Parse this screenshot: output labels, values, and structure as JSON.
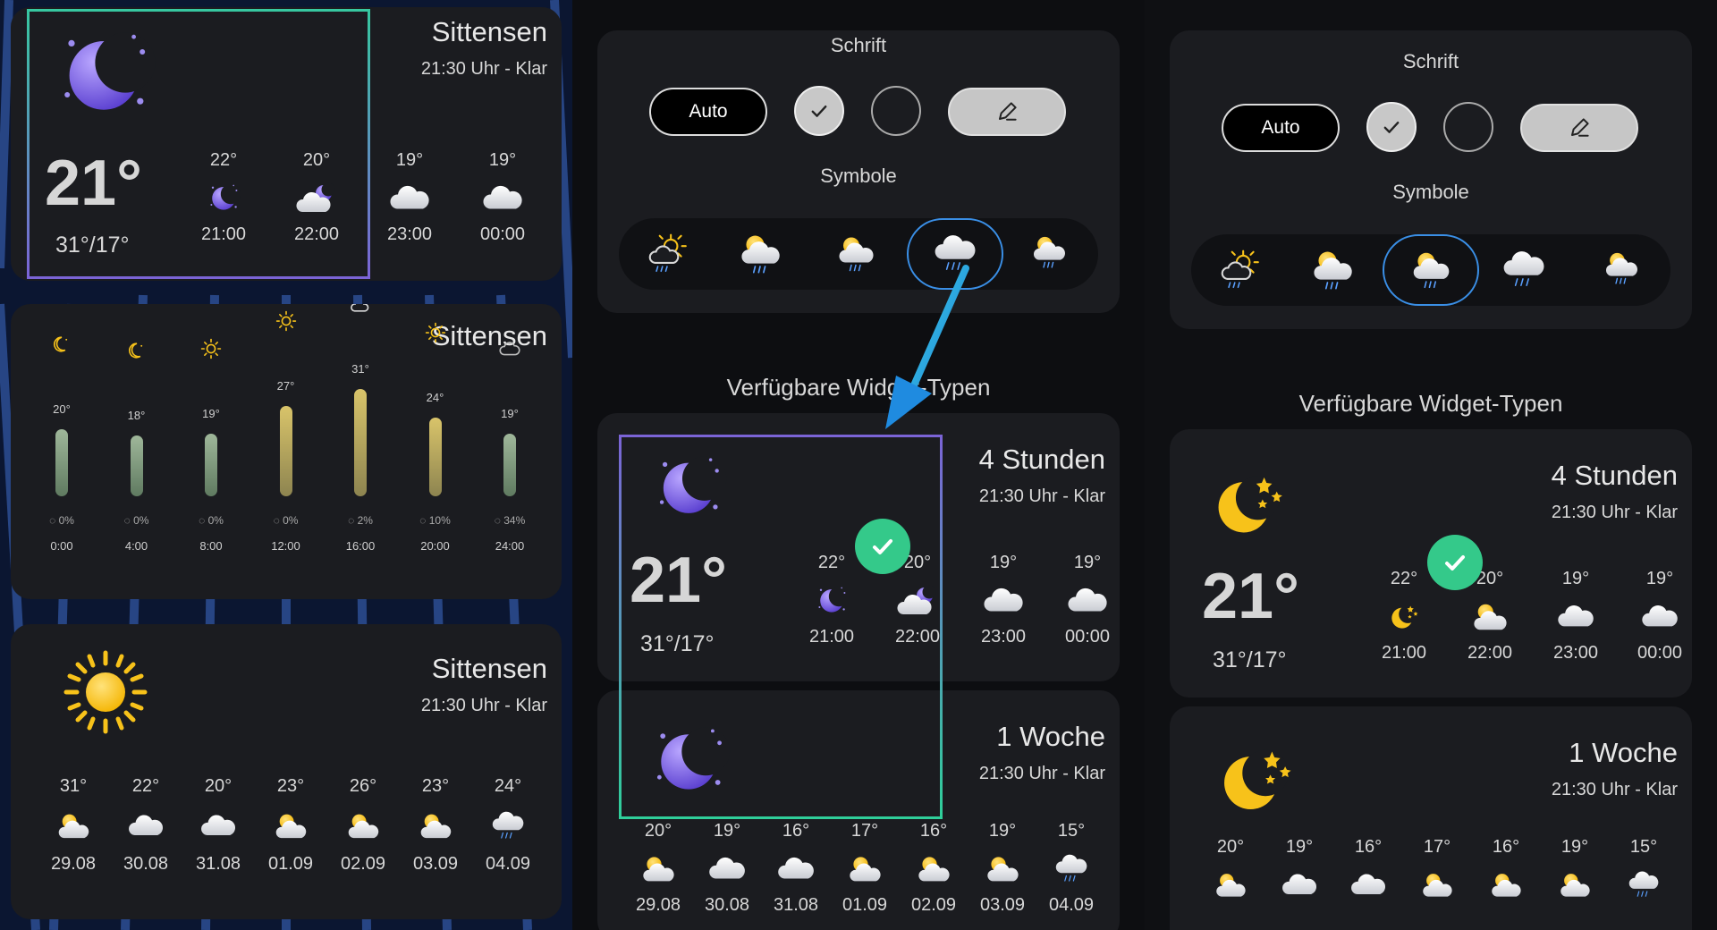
{
  "colors": {
    "accent_blue": "#3a8fe6",
    "highlight_violet": "#7b64d6",
    "highlight_teal": "#2fcf9a",
    "check_green": "#34c98a",
    "sun_yellow": "#f7c21a",
    "moon_purple": "#7f65e6"
  },
  "left": {
    "card1": {
      "location": "Sittensen",
      "subtitle": "21:30 Uhr - Klar",
      "current_temp": "21°",
      "range": "31°/17°",
      "hours": [
        {
          "temp": "22°",
          "time": "21:00",
          "icon": "moon-icon"
        },
        {
          "temp": "20°",
          "time": "22:00",
          "icon": "cloud-moon-icon"
        },
        {
          "temp": "19°",
          "time": "23:00",
          "icon": "cloud-icon"
        },
        {
          "temp": "19°",
          "time": "00:00",
          "icon": "cloud-icon"
        }
      ]
    },
    "card2": {
      "location": "Sittensen",
      "columns": [
        {
          "temp": "20°",
          "rain": "0%",
          "time": "0:00",
          "level": 0.58,
          "icon": "moon-outline-icon"
        },
        {
          "temp": "18°",
          "rain": "0%",
          "time": "4:00",
          "level": 0.52,
          "icon": "moon-outline-icon"
        },
        {
          "temp": "19°",
          "rain": "0%",
          "time": "8:00",
          "level": 0.54,
          "icon": "sun-outline-icon"
        },
        {
          "temp": "27°",
          "rain": "0%",
          "time": "12:00",
          "level": 0.78,
          "icon": "sun-outline-icon"
        },
        {
          "temp": "31°",
          "rain": "2%",
          "time": "16:00",
          "level": 0.92,
          "icon": "sun-cloud-outline-icon"
        },
        {
          "temp": "24°",
          "rain": "10%",
          "time": "20:00",
          "level": 0.68,
          "icon": "sun-outline-icon"
        },
        {
          "temp": "19°",
          "rain": "34%",
          "time": "24:00",
          "level": 0.54,
          "icon": "cloud-outline-icon"
        }
      ]
    },
    "card3": {
      "location": "Sittensen",
      "subtitle": "21:30 Uhr - Klar",
      "days": [
        {
          "temp": "31°",
          "date": "29.08",
          "icon": "sun-cloud-icon"
        },
        {
          "temp": "22°",
          "date": "30.08",
          "icon": "cloud-icon"
        },
        {
          "temp": "20°",
          "date": "31.08",
          "icon": "cloud-icon"
        },
        {
          "temp": "23°",
          "date": "01.09",
          "icon": "sun-cloud-icon"
        },
        {
          "temp": "26°",
          "date": "02.09",
          "icon": "sun-cloud-icon"
        },
        {
          "temp": "23°",
          "date": "03.09",
          "icon": "sun-cloud-icon"
        },
        {
          "temp": "24°",
          "date": "04.09",
          "icon": "rain-cloud-icon"
        }
      ]
    }
  },
  "settings": {
    "font_label": "Schrift",
    "auto_label": "Auto",
    "symbols_label": "Symbole",
    "available_title": "Verfügbare Widget-Typen"
  },
  "mid": {
    "w4h": {
      "title": "4 Stunden",
      "subtitle": "21:30 Uhr - Klar",
      "current_temp": "21°",
      "range": "31°/17°",
      "hours": [
        {
          "temp": "22°",
          "time": "21:00"
        },
        {
          "temp": "20°",
          "time": "22:00"
        },
        {
          "temp": "19°",
          "time": "23:00"
        },
        {
          "temp": "19°",
          "time": "00:00"
        }
      ]
    },
    "w1w": {
      "title": "1 Woche",
      "subtitle": "21:30 Uhr - Klar",
      "days": [
        {
          "temp": "20°",
          "date": "29.08"
        },
        {
          "temp": "19°",
          "date": "30.08"
        },
        {
          "temp": "16°",
          "date": "31.08"
        },
        {
          "temp": "17°",
          "date": "01.09"
        },
        {
          "temp": "16°",
          "date": "02.09"
        },
        {
          "temp": "19°",
          "date": "03.09"
        },
        {
          "temp": "15°",
          "date": "04.09"
        }
      ]
    }
  },
  "right": {
    "w4h": {
      "title": "4 Stunden",
      "subtitle": "21:30 Uhr - Klar",
      "current_temp": "21°",
      "range": "31°/17°",
      "hours": [
        {
          "temp": "22°",
          "time": "21:00"
        },
        {
          "temp": "20°",
          "time": "22:00"
        },
        {
          "temp": "19°",
          "time": "23:00"
        },
        {
          "temp": "19°",
          "time": "00:00"
        }
      ]
    },
    "w1w": {
      "title": "1 Woche",
      "subtitle": "21:30 Uhr - Klar",
      "temps": [
        "20°",
        "19°",
        "16°",
        "17°",
        "16°",
        "19°",
        "15°"
      ]
    }
  }
}
